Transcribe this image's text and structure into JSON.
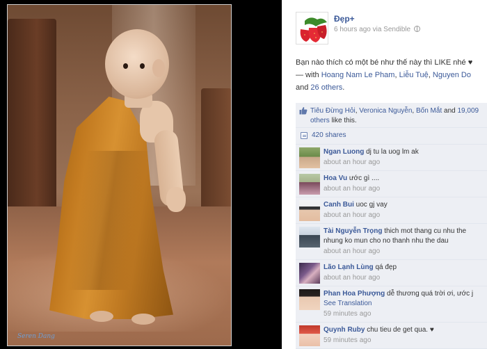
{
  "photo": {
    "watermark": "Seren Dang"
  },
  "post": {
    "page_name": "Đẹp+",
    "time": "6 hours ago via Sendible",
    "text": "Bạn nào thích có một bé như thế này thì LIKE nhé ♥",
    "with_prefix": "— with ",
    "tagged": [
      "Hoang Nam Le Pham",
      "Liễu Tuệ",
      "Nguyen Do"
    ],
    "and_word": "and",
    "others": "26 others",
    "period": "."
  },
  "likes": {
    "names": [
      "Tiêu Đừng Hỏi",
      "Veronica Nguyễn",
      "Bốn Mắt"
    ],
    "and_word": "and",
    "count": "19,009 others",
    "suffix": "like this."
  },
  "shares": {
    "label": "420 shares"
  },
  "comments": [
    {
      "author": "Ngan Luong",
      "text": "dj tu la uog lm ak",
      "time": "about an hour ago"
    },
    {
      "author": "Hoa Vu",
      "text": "ước gì ....",
      "time": "about an hour ago"
    },
    {
      "author": "Canh Bui",
      "text": "uoc gj vay",
      "time": "about an hour ago"
    },
    {
      "author": "Tài Nguyễn Trọng",
      "text": "thich mot thang cu nhu the nhung ko mun cho no thanh nhu the dau",
      "time": "about an hour ago"
    },
    {
      "author": "Lão Lạnh Lùng",
      "text": "qá đẹp",
      "time": "about an hour ago"
    },
    {
      "author": "Phan Hoa Phượng",
      "text": "dễ thương quá trời ơi, ước j",
      "see_translation": "See Translation",
      "time": "59 minutes ago"
    },
    {
      "author": "Quynh Ruby",
      "text": "chu tieu de get qua. ♥",
      "time": "59 minutes ago"
    }
  ],
  "colors": {
    "link": "#3b5998",
    "ufi_bg": "#edeff4",
    "meta": "#999999",
    "robe": "#c27a20"
  }
}
